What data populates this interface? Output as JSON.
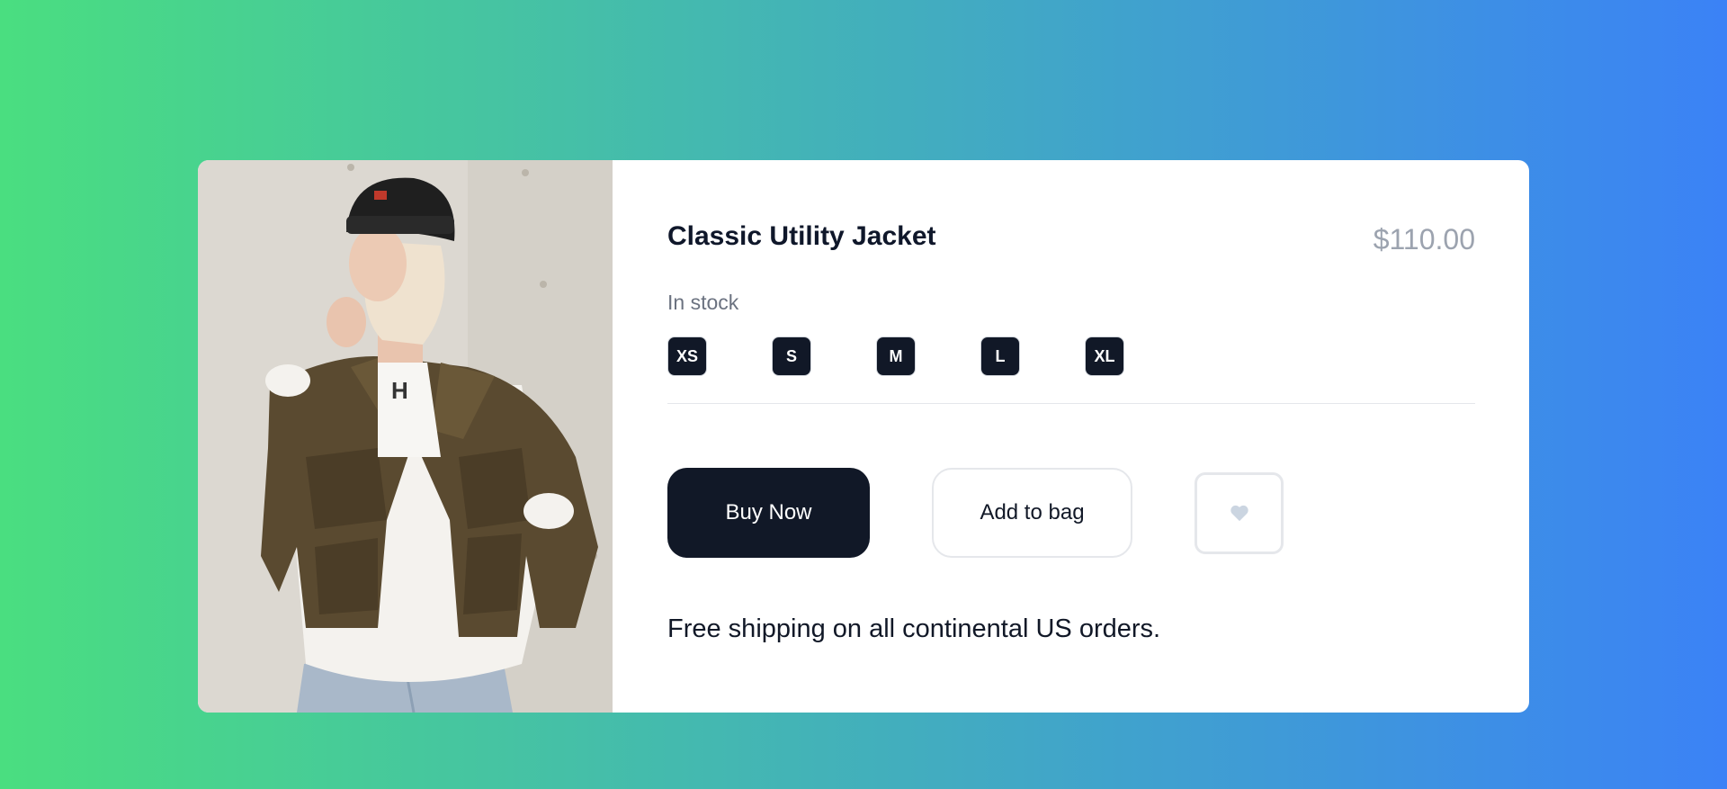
{
  "product": {
    "title": "Classic Utility Jacket",
    "price": "$110.00",
    "stock_status": "In stock",
    "sizes": [
      "XS",
      "S",
      "M",
      "L",
      "XL"
    ],
    "shipping_note": "Free shipping on all continental US orders."
  },
  "actions": {
    "buy_label": "Buy Now",
    "add_to_bag_label": "Add to bag",
    "favorite_icon": "heart-icon"
  },
  "colors": {
    "background_gradient_start": "#4ade80",
    "background_gradient_end": "#3b82f6",
    "primary_button": "#111827",
    "price_text": "#9ca3af",
    "muted_icon": "#cbd5e1"
  }
}
